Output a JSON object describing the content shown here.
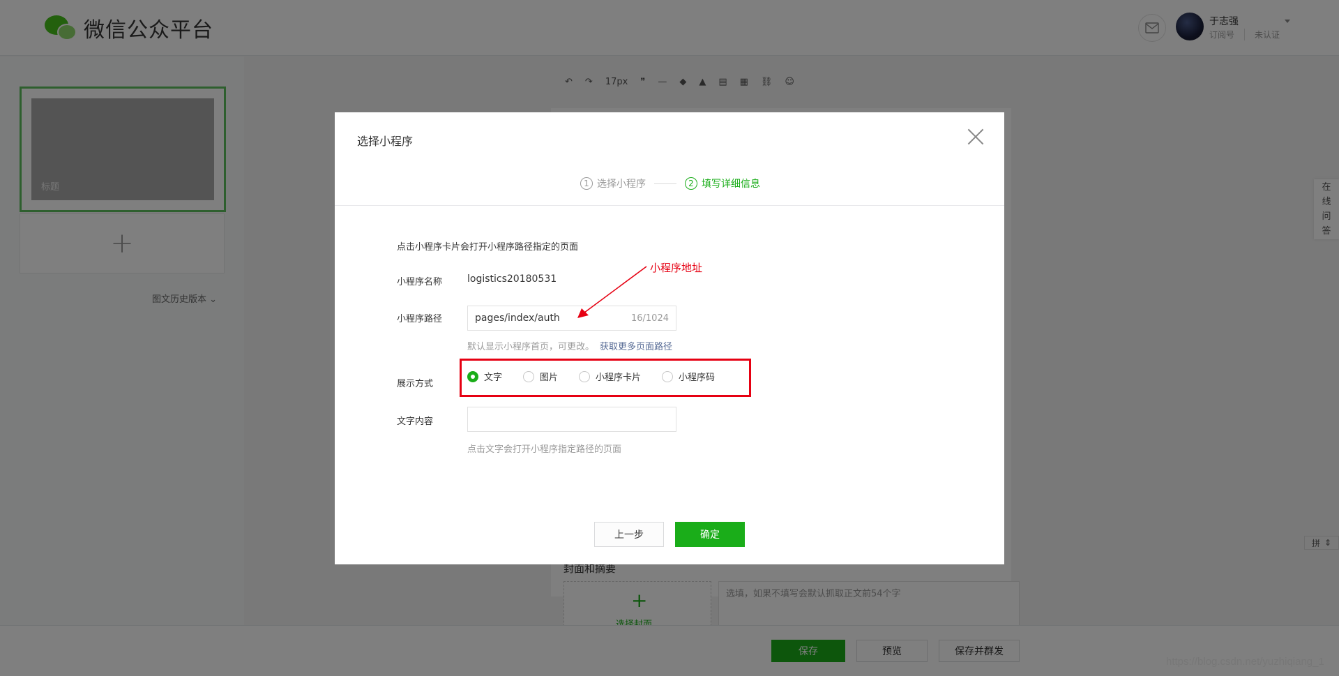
{
  "app": {
    "title": "微信公众平台"
  },
  "user": {
    "name": "于志强",
    "account_type": "订阅号",
    "verify_status": "未认证"
  },
  "left_panel": {
    "article_title": "标题",
    "add_label": "+",
    "history_label": "图文历史版本"
  },
  "editor": {
    "font_size": "17px",
    "cover_label": "封面和摘要",
    "cover_button": "选择封面",
    "cover_plus": "+",
    "summary_placeholder": "选填，如果不填写会默认抓取正文前54个字"
  },
  "bottom_bar": {
    "save": "保存",
    "preview": "预览",
    "save_and_publish": "保存并群发"
  },
  "help_tab": {
    "chars": [
      "在",
      "线",
      "问",
      "答"
    ]
  },
  "ime": {
    "label": "拼"
  },
  "watermark": "https://blog.csdn.net/yuzhiqiang_1",
  "dialog": {
    "title": "选择小程序",
    "steps": [
      {
        "num": "1",
        "label": "选择小程序"
      },
      {
        "num": "2",
        "label": "填写详细信息"
      }
    ],
    "intro": "点击小程序卡片会打开小程序路径指定的页面",
    "name_label": "小程序名称",
    "name_value": "logistics20180531",
    "path_label": "小程序路径",
    "path_value": "pages/index/auth",
    "path_count": "16/1024",
    "path_hint": "默认显示小程序首页，可更改。",
    "path_hint_link": "获取更多页面路径",
    "mode_label": "展示方式",
    "mode_options": [
      "文字",
      "图片",
      "小程序卡片",
      "小程序码"
    ],
    "mode_selected": "文字",
    "text_label": "文字内容",
    "text_value": "",
    "text_hint": "点击文字会打开小程序指定路径的页面",
    "prev_button": "上一步",
    "ok_button": "确定",
    "annotation": "小程序地址"
  },
  "colors": {
    "primary": "#1aad19",
    "link": "#576b95",
    "annotation": "#e60012"
  }
}
